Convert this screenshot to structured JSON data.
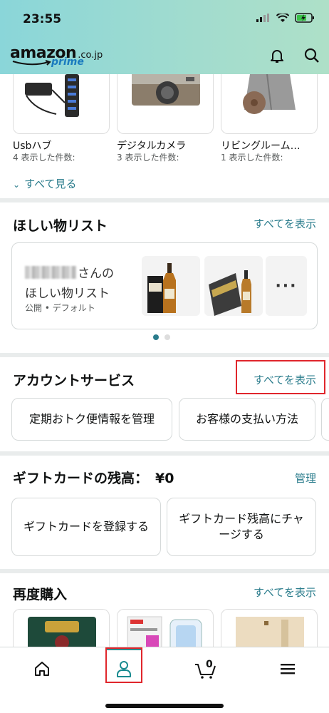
{
  "status": {
    "time": "23:55"
  },
  "header": {
    "logo_text": "amazon",
    "logo_suffix": ".co.jp",
    "logo_prime": "prime"
  },
  "viewed": {
    "items": [
      {
        "title": "Usbハブ",
        "count": "4 表示した件数:"
      },
      {
        "title": "デジタルカメラ",
        "count": "3 表示した件数:"
      },
      {
        "title": "リビングルーム…",
        "count": "1 表示した件数:"
      }
    ],
    "see_all": "すべて見る"
  },
  "wishlist": {
    "title": "ほしい物リスト",
    "link": "すべてを表示",
    "name_suffix": "さんの",
    "list_name": "ほしい物リスト",
    "meta": "公開 • デフォルト",
    "more": "···"
  },
  "account": {
    "title": "アカウントサービス",
    "link": "すべてを表示",
    "items": [
      "定期おトク便情報を管理",
      "お客様の支払い方法"
    ]
  },
  "gift": {
    "title": "ギフトカードの残高：",
    "amount": "¥0",
    "link": "管理",
    "buttons": [
      "ギフトカードを登録する",
      "ギフトカード残高にチャージする"
    ]
  },
  "rebuy": {
    "title": "再度購入",
    "link": "すべてを表示"
  },
  "bottom_nav": {
    "cart_count": "0"
  },
  "colors": {
    "accent": "#2a7c8c",
    "highlight": "#e0262c"
  }
}
